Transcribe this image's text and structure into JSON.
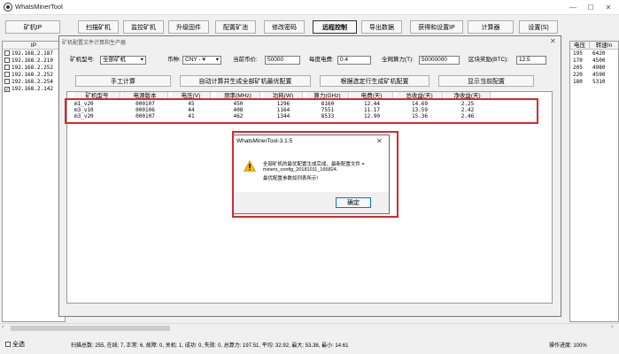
{
  "window": {
    "title": "WhatsMinerTool",
    "min": "—",
    "max": "☐",
    "close": "✕"
  },
  "toolbar": [
    {
      "label": "矿机IP",
      "bold": false
    },
    {
      "label": "扫描矿机",
      "bold": false
    },
    {
      "label": "监控矿机",
      "bold": false
    },
    {
      "label": "升级固件",
      "bold": false
    },
    {
      "label": "配置矿池",
      "bold": false
    },
    {
      "label": "修改密码",
      "bold": false
    },
    {
      "label": "远程控制",
      "bold": true
    },
    {
      "label": "导出数据",
      "bold": false
    },
    {
      "label": "获得和设置IP",
      "bold": false
    },
    {
      "label": "计算器",
      "bold": false
    },
    {
      "label": "设置(S)",
      "bold": false
    }
  ],
  "left_table": {
    "header": "IP",
    "rows": [
      {
        "ip": "192.168.2.187",
        "checked": false
      },
      {
        "ip": "192.168.2.210",
        "checked": false
      },
      {
        "ip": "192.168.2.252",
        "checked": false
      },
      {
        "ip": "192.168.2.252",
        "checked": false
      },
      {
        "ip": "192.168.2.254",
        "checked": false
      },
      {
        "ip": "192.168.2.142",
        "checked": true
      }
    ]
  },
  "right_table": {
    "headers": [
      "电压",
      "转速In"
    ],
    "rows": [
      [
        "195",
        "6420"
      ],
      [
        "170",
        "4500"
      ],
      [
        "205",
        "4980"
      ],
      [
        "220",
        "4590"
      ],
      [
        "180",
        "5310"
      ]
    ]
  },
  "config_window": {
    "title": "矿机配置文件计算和生产器",
    "close": "✕",
    "miner_type_label": "矿机型号:",
    "miner_type_value": "全部矿机",
    "currency_label": "币种:",
    "currency_value": "CNY - ¥",
    "price_label": "当前币价:",
    "price_value": "50000",
    "power_cost_label": "每度电费:",
    "power_cost_value": "0.4",
    "hashrate_label": "全网算力(T):",
    "hashrate_value": "50000000",
    "reward_label": "区块奖励(BTC):",
    "reward_value": "12.5",
    "buttons": [
      "手工计算",
      "自动计算并生成全部矿机最优配置",
      "根据选定行生成矿机配置",
      "显示当前配置"
    ],
    "columns": [
      "矿机型号",
      "电源版本",
      "电压(V)",
      "频率(MHz)",
      "功耗(W)",
      "算力(GHz)",
      "电费(天)",
      "总收益(天)",
      "净收益(天)"
    ],
    "rows": [
      [
        "m1_v20",
        "000107",
        "45",
        "450",
        "1296",
        "8160",
        "12.44",
        "14.69",
        "2.25"
      ],
      [
        "m3_v10",
        "000106",
        "44",
        "408",
        "1164",
        "7551",
        "11.17",
        "13.59",
        "2.42"
      ],
      [
        "m3_v20",
        "000107",
        "41",
        "462",
        "1344",
        "8533",
        "12.90",
        "15.36",
        "2.46"
      ]
    ]
  },
  "dialog": {
    "title": "WhatsMinerTool-3.1.5",
    "close": "✕",
    "line1": "全部矿机的最优配置生成完成，最新配置文件 =",
    "line2": "miners_config_20181011_165824.",
    "line3": "最优配置参数如列表所示!",
    "ok": "确定",
    "warning_icon": "warning-icon"
  },
  "status": {
    "select_all": "全选",
    "summary": "扫描总数: 255, 在线: 7, 正常: 6, 故障: 0, 关机: 1, 成功: 0, 失败: 0, 总算力: 197.51, 平均: 32.92, 最大: 53.38, 最小: 14.61",
    "progress": "操作进度: 100%"
  },
  "colors": {
    "highlight": "#d9282e",
    "warning": "#f5b800"
  }
}
